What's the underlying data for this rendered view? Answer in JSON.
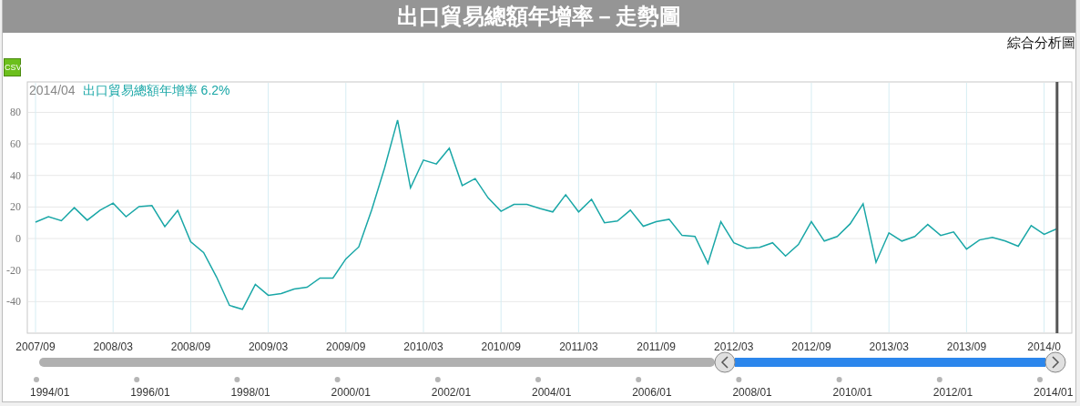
{
  "title": "出口貿易總額年增率－走勢圖",
  "analysis_link": "綜合分析圖",
  "csv_button": "CSV",
  "tooltip": {
    "date": "2014/04",
    "value": "6.2%"
  },
  "chart": {
    "chart_data": {
      "type": "line",
      "grid": true,
      "categories": [
        "2007/09",
        null,
        null,
        null,
        null,
        null,
        "2008/03",
        null,
        null,
        null,
        null,
        null,
        "2008/09",
        null,
        null,
        null,
        null,
        null,
        "2009/03",
        null,
        null,
        null,
        null,
        null,
        "2009/09",
        null,
        null,
        null,
        null,
        null,
        "2010/03",
        null,
        null,
        null,
        null,
        null,
        "2010/09",
        null,
        null,
        null,
        null,
        null,
        "2011/03",
        null,
        null,
        null,
        null,
        null,
        "2011/09",
        null,
        null,
        null,
        null,
        null,
        "2012/03",
        null,
        null,
        null,
        null,
        null,
        "2012/09",
        null,
        null,
        null,
        null,
        null,
        "2013/03",
        null,
        null,
        null,
        null,
        null,
        "2013/09",
        null,
        null,
        null,
        null,
        null,
        "2014/0",
        null
      ],
      "series": [
        {
          "name": "出口貿易總額年增率",
          "color": "#1aa7a7",
          "values": [
            10.4,
            13.8,
            11.3,
            19.6,
            11.6,
            18.0,
            22.4,
            13.8,
            20.2,
            20.9,
            7.6,
            17.8,
            -2.0,
            -8.9,
            -24.4,
            -42.4,
            -44.9,
            -29.1,
            -36.0,
            -34.9,
            -32.0,
            -30.9,
            -25.1,
            -25.1,
            -12.9,
            -5.3,
            18.2,
            44.9,
            75.1,
            32.2,
            49.8,
            47.3,
            57.3,
            33.6,
            38.0,
            25.8,
            17.3,
            21.6,
            21.6,
            19.1,
            16.9,
            27.8,
            16.9,
            24.9,
            10.0,
            11.1,
            18.0,
            7.8,
            10.7,
            12.2,
            2.0,
            1.3,
            -15.8,
            10.7,
            -2.7,
            -6.2,
            -5.6,
            -2.7,
            -11.1,
            -3.8,
            10.7,
            -1.6,
            1.3,
            9.3,
            22.0,
            -15.1,
            3.6,
            -1.6,
            1.3,
            8.9,
            2.0,
            4.2,
            -6.7,
            -0.9,
            0.7,
            -1.6,
            -4.9,
            8.2,
            2.7,
            6.2
          ]
        }
      ],
      "ylim": [
        -60,
        99.3
      ],
      "yticks": [
        -40,
        -20,
        0,
        20,
        40,
        60,
        80
      ]
    }
  },
  "navigator": {
    "level": 0.305,
    "ticks": [
      "1994/01",
      "1996/01",
      "1998/01",
      "2000/01",
      "2002/01",
      "2004/01",
      "2006/01",
      "2008/01",
      "2010/01",
      "2012/01",
      "2014/01"
    ]
  }
}
